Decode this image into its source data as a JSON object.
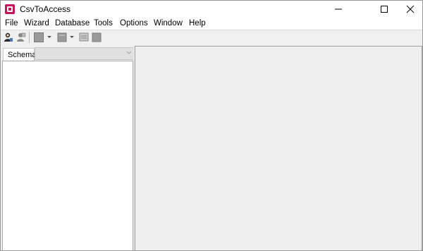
{
  "window": {
    "title": "CsvToAccess",
    "controls": [
      "minimize-icon",
      "maximize-icon",
      "close-icon"
    ]
  },
  "menu": {
    "items": [
      "File",
      "Wizard",
      "Database",
      "Tools",
      "Options",
      "Window",
      "Help"
    ]
  },
  "toolbar": {
    "buttons": [
      "user-connect-icon",
      "user-settings-icon",
      "table-icon",
      "dropdown-arrow-icon",
      "import-icon",
      "dropdown-arrow-icon",
      "export-icon",
      "stop-icon"
    ]
  },
  "left_panel": {
    "tab_label": "Schema",
    "select_value": ""
  },
  "colors": {
    "app_icon": "#c2185b",
    "chrome": "#f0f0f0",
    "workspace": "#efefef"
  }
}
